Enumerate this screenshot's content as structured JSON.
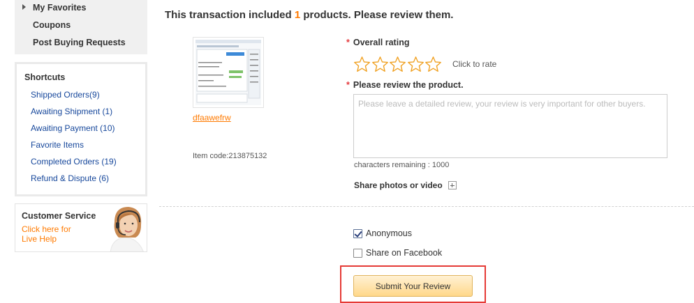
{
  "sidebar": {
    "nav_items": [
      "My Favorites",
      "Coupons",
      "Post Buying Requests"
    ],
    "shortcuts": {
      "title": "Shortcuts",
      "links": [
        "Shipped Orders(9)",
        "Awaiting Shipment (1)",
        "Awaiting Payment (10)",
        "Favorite Items",
        "Completed Orders (19)",
        "Refund & Dispute (6)"
      ]
    },
    "customer_service": {
      "title": "Customer Service",
      "link_line1": "Click here for",
      "link_line2": "Live Help"
    }
  },
  "main": {
    "heading_prefix": "This transaction included ",
    "product_count": "1",
    "heading_suffix": " products. Please review them.",
    "product": {
      "name": "dfaawefrw",
      "item_code": "Item code:213875132"
    },
    "overall_rating_label": "Overall rating",
    "rating_value": 0,
    "rating_max": 5,
    "click_to_rate": "Click to rate",
    "review_label": "Please review the product.",
    "review_placeholder": "Please leave a detailed review, your review is very important for other buyers.",
    "characters_remaining": "characters remaining : 1000",
    "share_photos": "Share photos or video",
    "anonymous_label": "Anonymous",
    "anonymous_checked": true,
    "share_facebook_label": "Share on Facebook",
    "share_facebook_checked": false,
    "submit_label": "Submit Your Review"
  },
  "colors": {
    "accent_orange": "#ff7a00",
    "link_blue": "#16479b",
    "required_red": "#e4393c",
    "star_outline": "#f0a020",
    "highlight_red": "#e53935"
  }
}
